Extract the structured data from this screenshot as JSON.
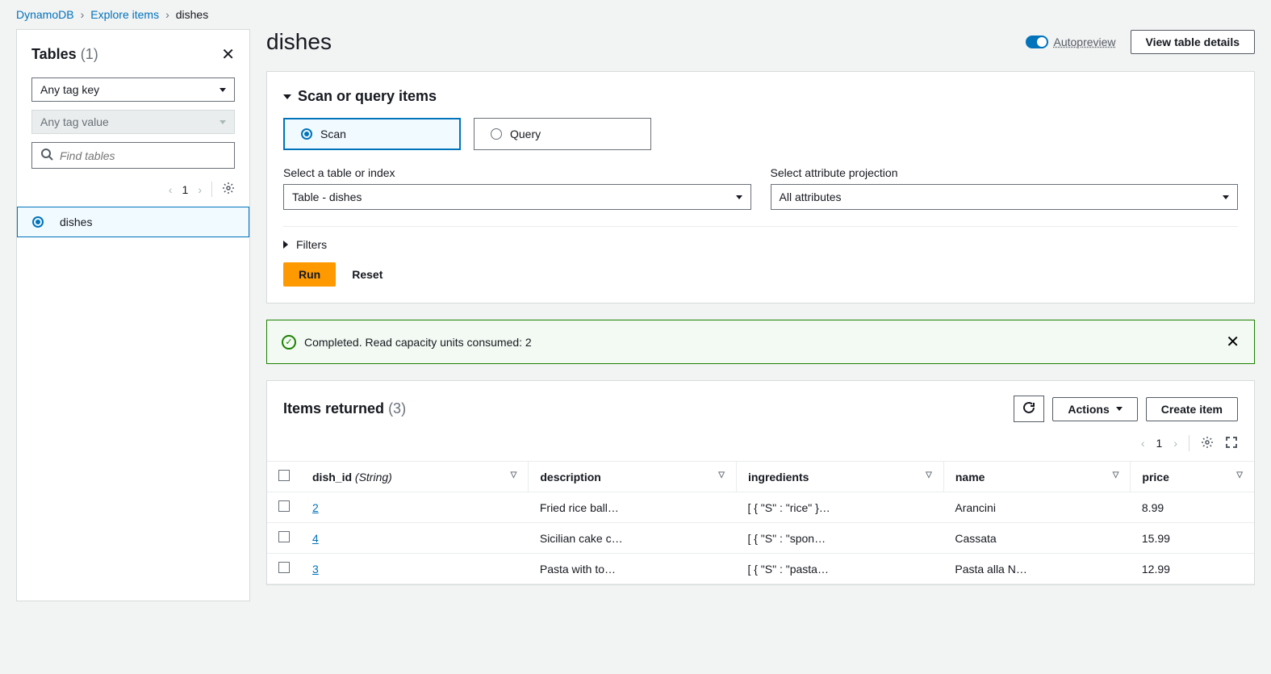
{
  "breadcrumb": {
    "service": "DynamoDB",
    "section": "Explore items",
    "current": "dishes"
  },
  "sidebar": {
    "title": "Tables",
    "count": "(1)",
    "tagKeyPlaceholder": "Any tag key",
    "tagValuePlaceholder": "Any tag value",
    "searchPlaceholder": "Find tables",
    "page": "1",
    "items": [
      {
        "name": "dishes",
        "selected": true
      }
    ]
  },
  "header": {
    "title": "dishes",
    "autopreview": "Autopreview",
    "viewDetails": "View table details"
  },
  "scanQuery": {
    "title": "Scan or query items",
    "scanLabel": "Scan",
    "queryLabel": "Query",
    "tableLabel": "Select a table or index",
    "tableValue": "Table - dishes",
    "projectionLabel": "Select attribute projection",
    "projectionValue": "All attributes",
    "filtersLabel": "Filters",
    "runLabel": "Run",
    "resetLabel": "Reset"
  },
  "alert": {
    "message": "Completed. Read capacity units consumed: 2"
  },
  "results": {
    "title": "Items returned",
    "count": "(3)",
    "actionsLabel": "Actions",
    "createLabel": "Create item",
    "page": "1",
    "columns": [
      {
        "key": "dish_id",
        "label": "dish_id",
        "type": "(String)"
      },
      {
        "key": "description",
        "label": "description"
      },
      {
        "key": "ingredients",
        "label": "ingredients"
      },
      {
        "key": "name",
        "label": "name"
      },
      {
        "key": "price",
        "label": "price"
      }
    ],
    "rows": [
      {
        "dish_id": "2",
        "description": "Fried rice ball…",
        "ingredients": "[ { \"S\" : \"rice\" }…",
        "name": "Arancini",
        "price": "8.99"
      },
      {
        "dish_id": "4",
        "description": "Sicilian cake c…",
        "ingredients": "[ { \"S\" : \"spon…",
        "name": "Cassata",
        "price": "15.99"
      },
      {
        "dish_id": "3",
        "description": "Pasta with to…",
        "ingredients": "[ { \"S\" : \"pasta…",
        "name": "Pasta alla N…",
        "price": "12.99"
      }
    ]
  }
}
